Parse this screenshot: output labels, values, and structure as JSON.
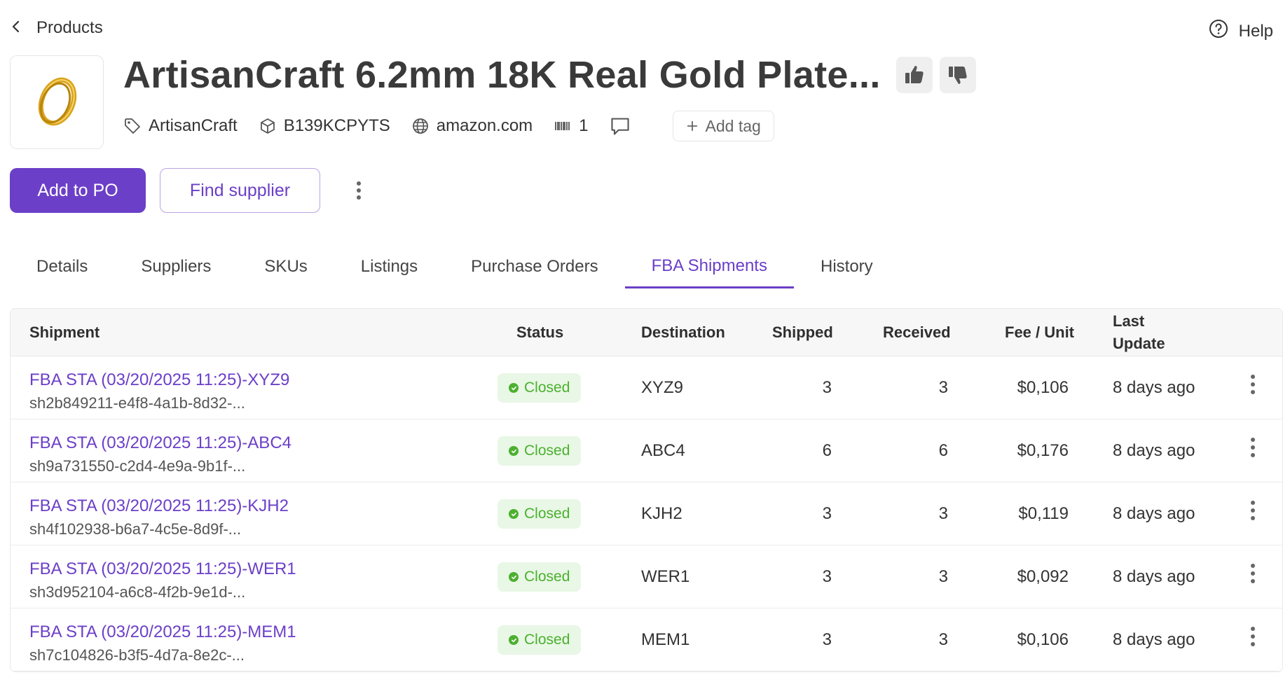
{
  "nav": {
    "back_label": "Products",
    "help_label": "Help"
  },
  "product": {
    "title": "ArtisanCraft 6.2mm 18K Real Gold Plate...",
    "brand": "ArtisanCraft",
    "asin": "B139KCPYTS",
    "marketplace": "amazon.com",
    "barcode_count": "1",
    "add_tag_label": "Add tag"
  },
  "actions": {
    "add_to_po": "Add to PO",
    "find_supplier": "Find supplier"
  },
  "tabs": [
    {
      "label": "Details"
    },
    {
      "label": "Suppliers"
    },
    {
      "label": "SKUs"
    },
    {
      "label": "Listings"
    },
    {
      "label": "Purchase Orders"
    },
    {
      "label": "FBA Shipments"
    },
    {
      "label": "History"
    }
  ],
  "active_tab": "FBA Shipments",
  "table": {
    "headers": {
      "shipment": "Shipment",
      "status": "Status",
      "destination": "Destination",
      "shipped": "Shipped",
      "received": "Received",
      "fee_unit": "Fee / Unit",
      "last_update_1": "Last",
      "last_update_2": "Update"
    },
    "rows": [
      {
        "name": "FBA STA (03/20/2025 11:25)-XYZ9",
        "id": "sh2b849211-e4f8-4a1b-8d32-...",
        "status": "Closed",
        "destination": "XYZ9",
        "shipped": "3",
        "received": "3",
        "fee": "$0,106",
        "updated": "8 days ago"
      },
      {
        "name": "FBA STA (03/20/2025 11:25)-ABC4",
        "id": "sh9a731550-c2d4-4e9a-9b1f-...",
        "status": "Closed",
        "destination": "ABC4",
        "shipped": "6",
        "received": "6",
        "fee": "$0,176",
        "updated": "8 days ago"
      },
      {
        "name": "FBA STA (03/20/2025 11:25)-KJH2",
        "id": "sh4f102938-b6a7-4c5e-8d9f-...",
        "status": "Closed",
        "destination": "KJH2",
        "shipped": "3",
        "received": "3",
        "fee": "$0,119",
        "updated": "8 days ago"
      },
      {
        "name": "FBA STA (03/20/2025 11:25)-WER1",
        "id": "sh3d952104-a6c8-4f2b-9e1d-...",
        "status": "Closed",
        "destination": "WER1",
        "shipped": "3",
        "received": "3",
        "fee": "$0,092",
        "updated": "8 days ago"
      },
      {
        "name": "FBA STA (03/20/2025 11:25)-MEM1",
        "id": "sh7c104826-b3f5-4d7a-8e2c-...",
        "status": "Closed",
        "destination": "MEM1",
        "shipped": "3",
        "received": "3",
        "fee": "$0,106",
        "updated": "8 days ago"
      }
    ]
  },
  "colors": {
    "accent": "#6b3fc8",
    "status_green": "#4bb02f",
    "status_bg": "#e9f7e6"
  },
  "icons": [
    "chevron-left-icon",
    "help-circle-icon",
    "thumbs-up-icon",
    "thumbs-down-icon",
    "tag-icon",
    "box-icon",
    "globe-icon",
    "barcode-icon",
    "comment-icon",
    "plus-icon",
    "more-vertical-icon",
    "check-icon"
  ]
}
